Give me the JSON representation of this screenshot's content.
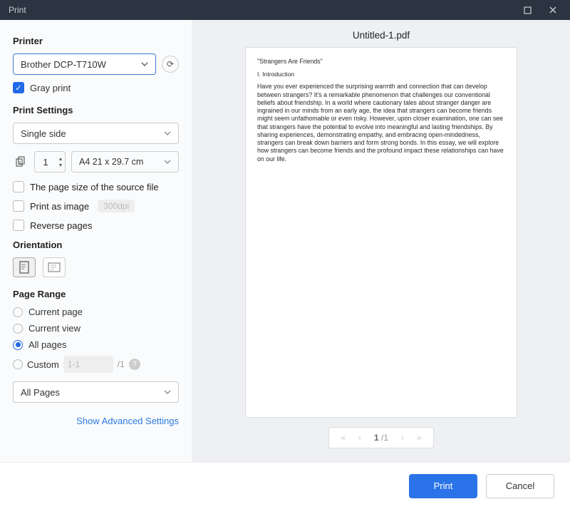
{
  "titlebar": {
    "title": "Print"
  },
  "sidebar": {
    "printer_label": "Printer",
    "printer_selected": "Brother DCP-T710W",
    "gray_print": "Gray print",
    "settings_label": "Print Settings",
    "sides": "Single side",
    "copies": "1",
    "paper_size": "A4 21 x 29.7 cm",
    "opt_source_size": "The page size of the source file",
    "opt_print_image": "Print as image",
    "dpi_placeholder": "300dpi",
    "opt_reverse": "Reverse pages",
    "orientation_label": "Orientation",
    "page_range_label": "Page Range",
    "pr_current_page": "Current page",
    "pr_current_view": "Current view",
    "pr_all_pages": "All pages",
    "pr_custom": "Custom",
    "custom_placeholder": "1-1",
    "custom_total": "/1",
    "pages_filter": "All Pages",
    "advanced_link": "Show Advanced Settings"
  },
  "preview": {
    "filename": "Untitled-1.pdf",
    "doc_title": "\"Strangers Are Friends\"",
    "section_heading": "I. Introduction",
    "paragraph": "Have you ever experienced the surprising warmth and connection that can develop between strangers? It's a remarkable phenomenon that challenges our conventional beliefs about friendship. In a world where cautionary tales about stranger danger are ingrained in our minds from an early age, the idea that strangers can become friends might seem unfathomable or even risky. However, upon closer examination, one can see that strangers have the potential to evolve into meaningful and lasting friendships. By sharing experiences, demonstrating empathy, and embracing open-mindedness, strangers can break down barriers and form strong bonds. In this essay, we will explore how strangers can become friends and the profound impact these relationships can have on our life."
  },
  "pager": {
    "current": "1",
    "total": "/1"
  },
  "footer": {
    "print": "Print",
    "cancel": "Cancel"
  }
}
